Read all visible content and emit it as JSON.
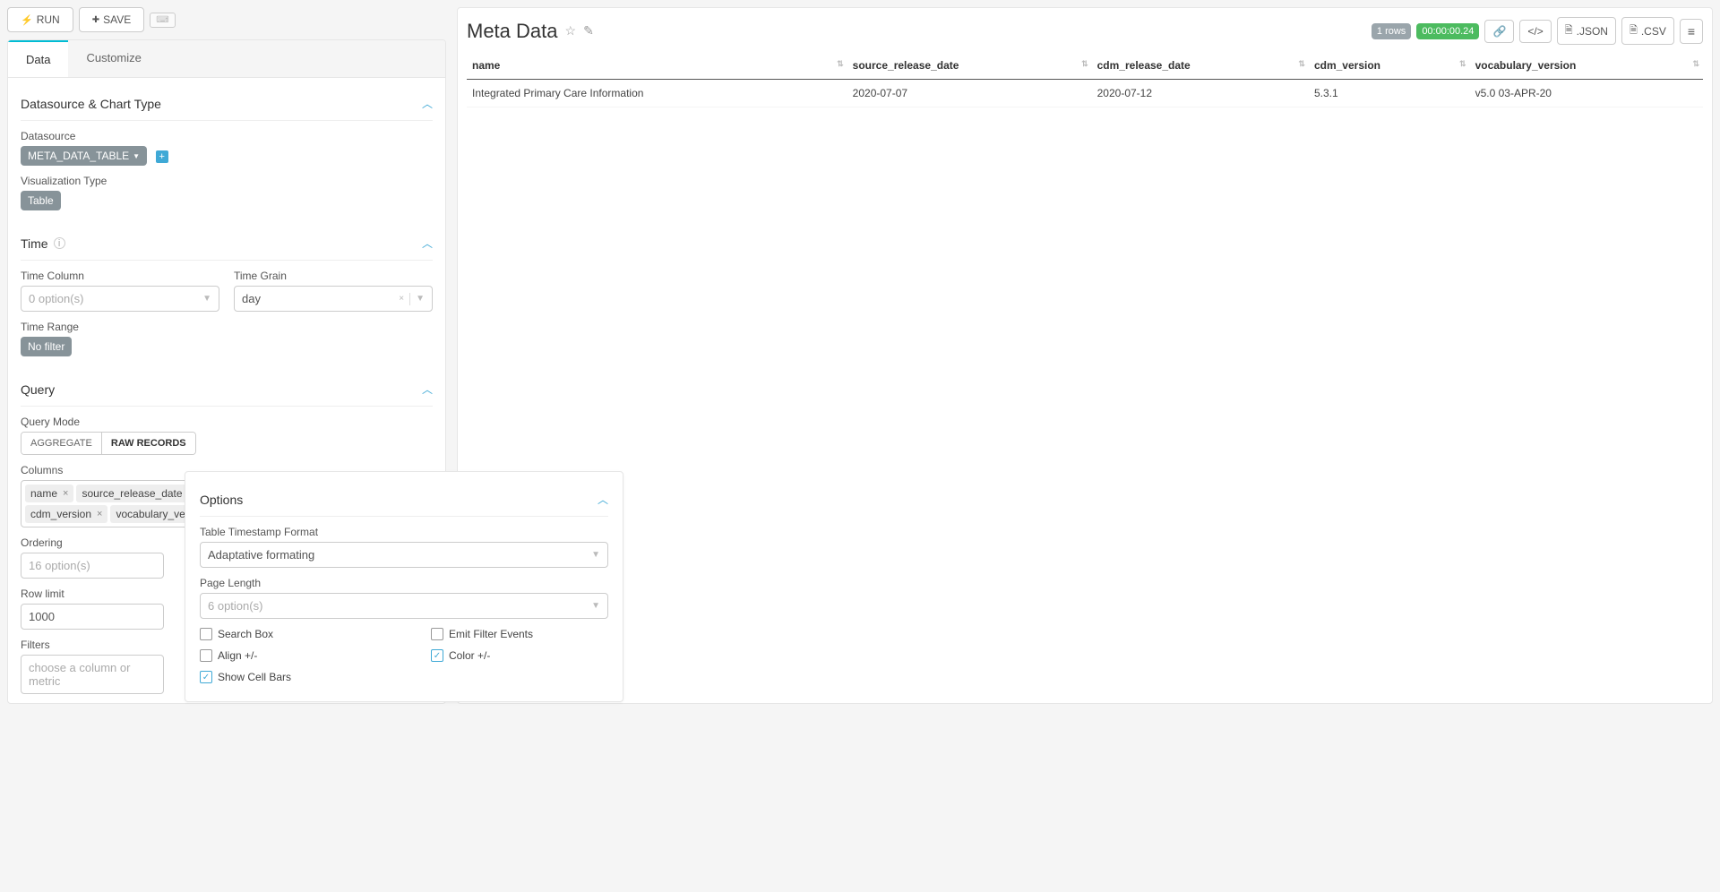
{
  "topbar": {
    "run": "RUN",
    "save": "SAVE",
    "kbd": "⌨"
  },
  "tabs": {
    "data": "Data",
    "customize": "Customize"
  },
  "sections": {
    "datasource": {
      "title": "Datasource & Chart Type",
      "datasource_label": "Datasource",
      "datasource_value": "META_DATA_TABLE",
      "viz_label": "Visualization Type",
      "viz_value": "Table"
    },
    "time": {
      "title": "Time",
      "col_label": "Time Column",
      "col_placeholder": "0 option(s)",
      "grain_label": "Time Grain",
      "grain_value": "day",
      "range_label": "Time Range",
      "range_value": "No filter"
    },
    "query": {
      "title": "Query",
      "mode_label": "Query Mode",
      "mode_aggregate": "AGGREGATE",
      "mode_raw": "RAW RECORDS",
      "columns_label": "Columns",
      "columns": [
        "name",
        "source_release_date",
        "cdm_release_date",
        "cdm_version",
        "vocabulary_version"
      ],
      "ordering_label": "Ordering",
      "ordering_placeholder": "16 option(s)",
      "rowlimit_label": "Row limit",
      "rowlimit_value": "1000",
      "filters_label": "Filters",
      "filters_placeholder": "choose a column or metric"
    }
  },
  "options": {
    "title": "Options",
    "ttf_label": "Table Timestamp Format",
    "ttf_value": "Adaptative formating",
    "pl_label": "Page Length",
    "pl_placeholder": "6 option(s)",
    "chk_search": "Search Box",
    "chk_emit": "Emit Filter Events",
    "chk_align": "Align +/-",
    "chk_color": "Color +/-",
    "chk_cellbars": "Show Cell Bars"
  },
  "results": {
    "title": "Meta Data",
    "rows_badge": "1 rows",
    "time_badge": "00:00:00.24",
    "json": ".JSON",
    "csv": ".CSV",
    "headers": [
      "name",
      "source_release_date",
      "cdm_release_date",
      "cdm_version",
      "vocabulary_version"
    ],
    "row": {
      "name": "Integrated Primary Care Information",
      "source_release_date": "2020-07-07",
      "cdm_release_date": "2020-07-12",
      "cdm_version": "5.3.1",
      "vocabulary_version": "v5.0 03-APR-20"
    }
  }
}
